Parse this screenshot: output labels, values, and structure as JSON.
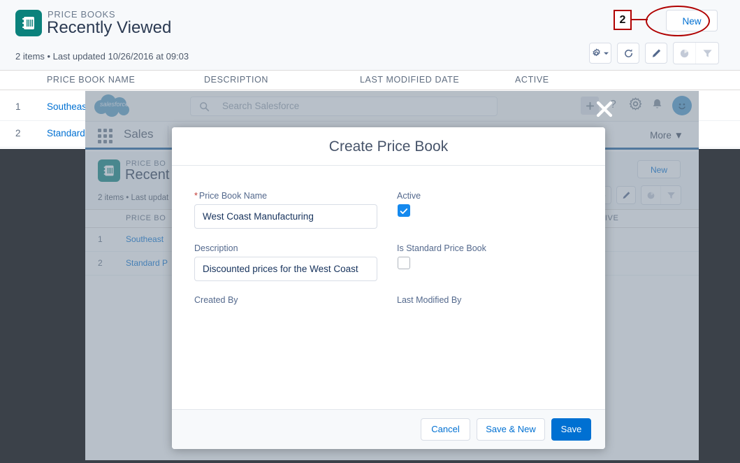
{
  "outer": {
    "eyebrow": "PRICE BOOKS",
    "title": "Recently Viewed",
    "meta": "2 items • Last updated 10/26/2016 at 09:03",
    "new_label": "New",
    "columns": [
      "PRICE BOOK NAME",
      "DESCRIPTION",
      "LAST MODIFIED DATE",
      "ACTIVE"
    ],
    "rows": [
      {
        "num": "1",
        "name": "Southeas"
      },
      {
        "num": "2",
        "name": "Standard"
      }
    ],
    "toolbar": {
      "settings": "gear-icon",
      "refresh": "refresh-icon",
      "edit": "pencil-icon",
      "chart": "chart-icon",
      "filter": "filter-icon"
    }
  },
  "annotation": {
    "step_number": "2",
    "color": "#b00000",
    "target": "New"
  },
  "inner": {
    "global_header": {
      "logo": "salesforce",
      "search_placeholder": "Search Salesforce",
      "icons": [
        "plus-icon",
        "question-icon",
        "gear-icon",
        "bell-icon",
        "avatar-icon"
      ]
    },
    "nav": {
      "app_name": "Sales",
      "more_label": "More"
    },
    "list": {
      "eyebrow": "PRICE BO",
      "title": "Recent",
      "meta": "2 items • Last updat",
      "new_label": "New",
      "columns": [
        "PRICE BO",
        "CTIVE"
      ],
      "rows": [
        {
          "num": "1",
          "name": "Southeast"
        },
        {
          "num": "2",
          "name": "Standard P"
        }
      ]
    }
  },
  "modal": {
    "title": "Create Price Book",
    "close_label": "close-icon",
    "fields": {
      "name_label": "Price Book Name",
      "name_required": "*",
      "name_value": "West Coast Manufacturing",
      "description_label": "Description",
      "description_value": "Discounted prices for the West Coast",
      "created_by_label": "Created By",
      "created_by_value": "",
      "active_label": "Active",
      "active_checked": true,
      "is_standard_label": "Is Standard Price Book",
      "is_standard_checked": false,
      "last_modified_by_label": "Last Modified By",
      "last_modified_by_value": ""
    },
    "buttons": {
      "cancel": "Cancel",
      "save_new": "Save & New",
      "save": "Save"
    }
  },
  "colors": {
    "brand_blue": "#0070d2",
    "checkbox_blue": "#1589ee",
    "pricebook_teal": "#0b827c",
    "annotation_red": "#b00000",
    "link_blue": "#0070d2"
  }
}
